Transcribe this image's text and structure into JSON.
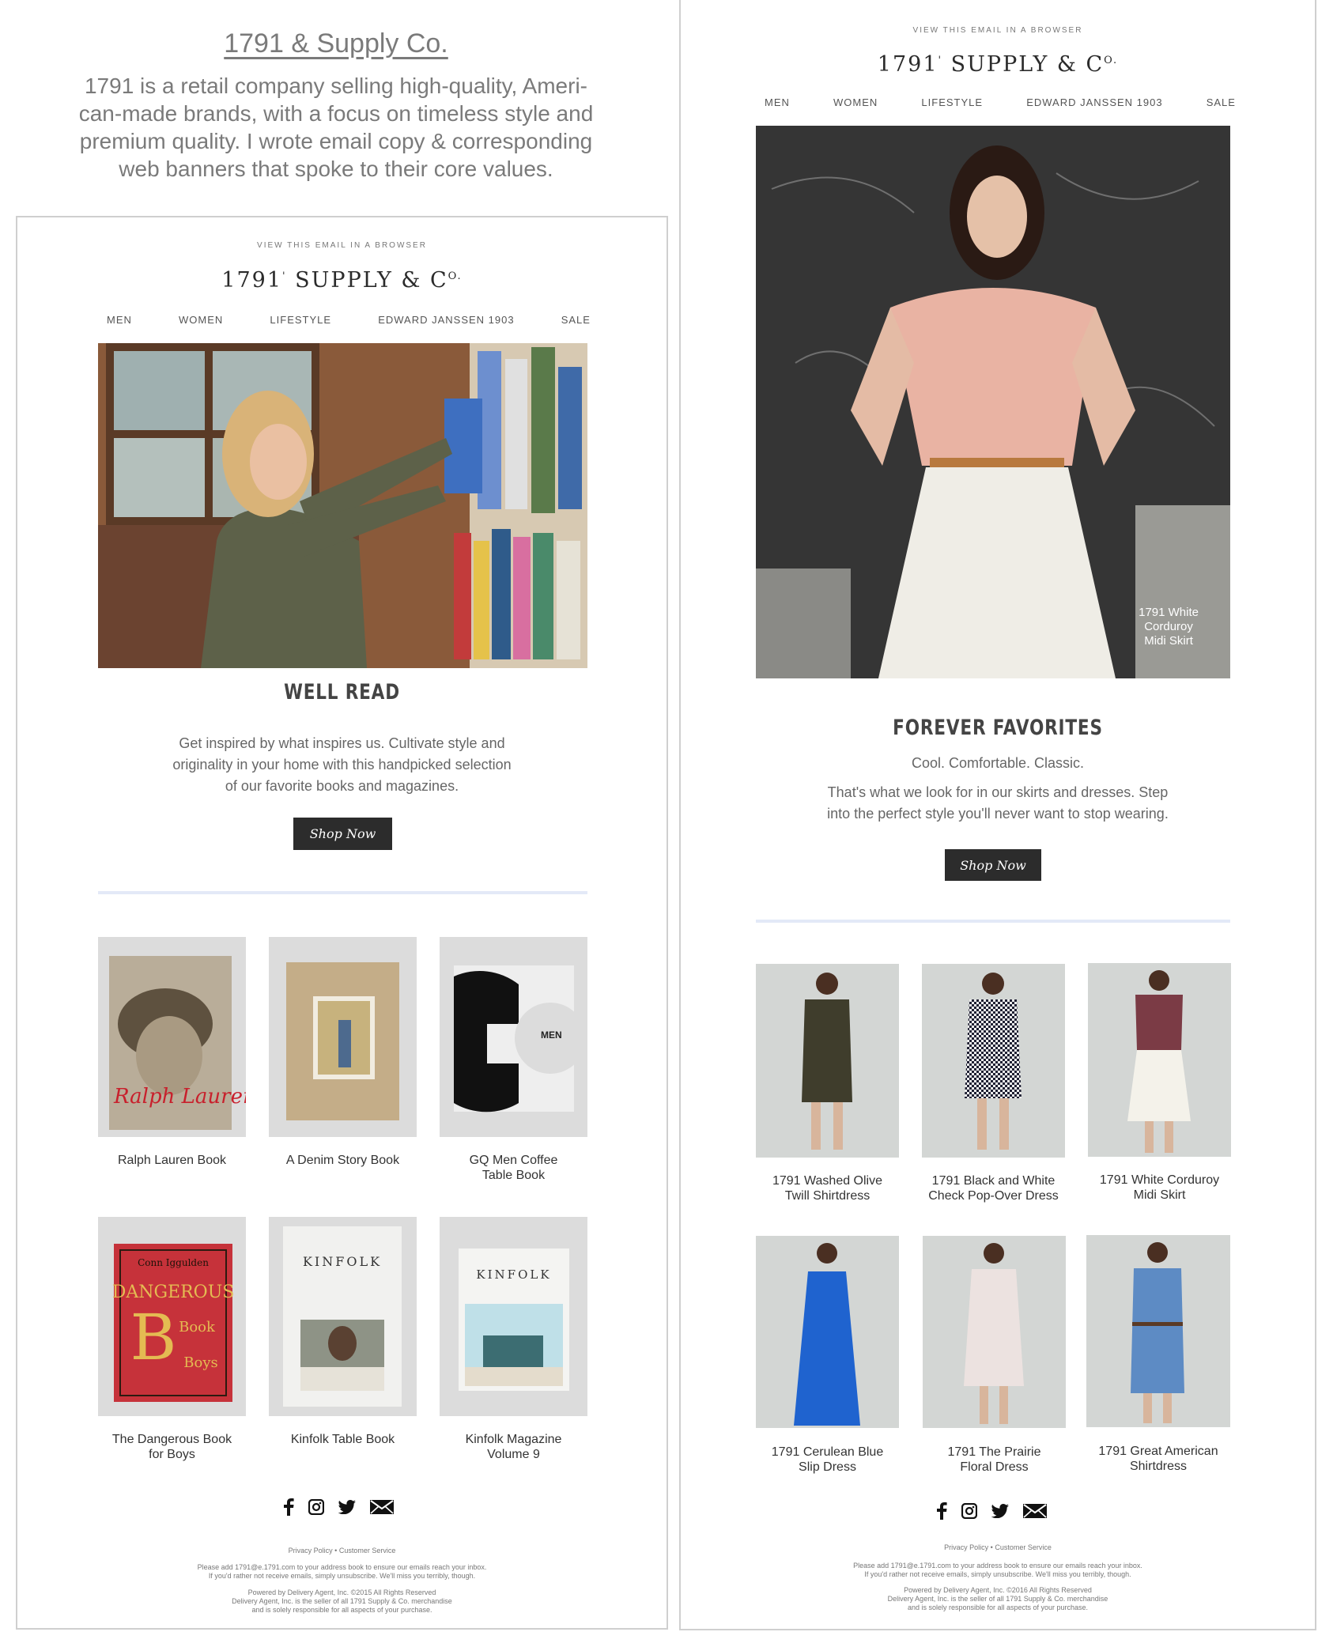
{
  "intro": {
    "title": "1791 & Supply Co.",
    "description_lines": [
      "1791 is a retail company selling high-quality, Ameri-",
      "can-made brands, with a focus on timeless style and",
      "premium quality. I wrote email copy & corresponding",
      "web banners that spoke to their core values."
    ]
  },
  "emails": [
    {
      "view_in_browser": "VIEW THIS EMAIL IN A BROWSER",
      "logo": "1791 SUPPLY & CO.",
      "nav": [
        "MEN",
        "WOMEN",
        "LIFESTYLE",
        "EDWARD JANSSEN 1903",
        "SALE"
      ],
      "hero_caption": "",
      "heading": "WELL READ",
      "subheading": "",
      "body_lines": [
        "Get inspired by what inspires us. Cultivate style and",
        "originality in your home with this handpicked selection",
        "of our favorite books and magazines."
      ],
      "button": "Shop Now",
      "products": [
        {
          "name": [
            "Ralph Lauren Book"
          ]
        },
        {
          "name": [
            "A Denim Story Book"
          ]
        },
        {
          "name": [
            "GQ Men Coffee",
            "Table Book"
          ]
        },
        {
          "name": [
            "The Dangerous Book",
            "for Boys"
          ]
        },
        {
          "name": [
            "Kinfolk Table Book"
          ]
        },
        {
          "name": [
            "Kinfolk Magazine",
            "Volume 9"
          ]
        }
      ],
      "footer_links": "Privacy Policy • Customer Service",
      "footer_note_1": [
        "Please add 1791@e.1791.com to your address book to ensure our emails reach your inbox.",
        "If you'd rather not receive emails, simply unsubscribe. We'll miss you terribly, though."
      ],
      "footer_note_2": [
        "Powered by Delivery Agent, Inc. ©2015 All Rights Reserved",
        "Delivery Agent, Inc. is the seller of all 1791 Supply & Co. merchandise",
        "and is solely responsible for all aspects of your purchase."
      ]
    },
    {
      "view_in_browser": "VIEW THIS EMAIL IN A BROWSER",
      "logo": "1791 SUPPLY & CO.",
      "nav": [
        "MEN",
        "WOMEN",
        "LIFESTYLE",
        "EDWARD JANSSEN 1903",
        "SALE"
      ],
      "hero_caption": [
        "1791 White",
        "Corduroy",
        "Midi Skirt"
      ],
      "heading": "FOREVER FAVORITES",
      "subheading": "Cool. Comfortable. Classic.",
      "body_lines": [
        "That's what we look for in our skirts and dresses. Step",
        "into the perfect style you'll never want to stop wearing."
      ],
      "button": "Shop Now",
      "products": [
        {
          "name": [
            "1791 Washed Olive",
            "Twill Shirtdress"
          ]
        },
        {
          "name": [
            "1791 Black and White",
            "Check Pop-Over Dress"
          ]
        },
        {
          "name": [
            "1791 White Corduroy",
            "Midi Skirt"
          ]
        },
        {
          "name": [
            "1791 Cerulean Blue",
            "Slip Dress"
          ]
        },
        {
          "name": [
            "1791 The Prairie",
            "Floral Dress"
          ]
        },
        {
          "name": [
            "1791 Great American",
            "Shirtdress"
          ]
        }
      ],
      "footer_links": "Privacy Policy • Customer Service",
      "footer_note_1": [
        "Please add 1791@e.1791.com to your address book to ensure our emails reach your inbox.",
        "If you'd rather not receive emails, simply unsubscribe. We'll miss you terribly, though."
      ],
      "footer_note_2": [
        "Powered by Delivery Agent, Inc. ©2016 All Rights Reserved",
        "Delivery Agent, Inc. is the seller of all 1791 Supply & Co. merchandise",
        "and is solely responsible for all aspects of your purchase."
      ]
    }
  ],
  "colors": {
    "button_bg": "#2c2c2c",
    "divider": "#e3e9f7",
    "frame_border": "#cfcfcf"
  }
}
